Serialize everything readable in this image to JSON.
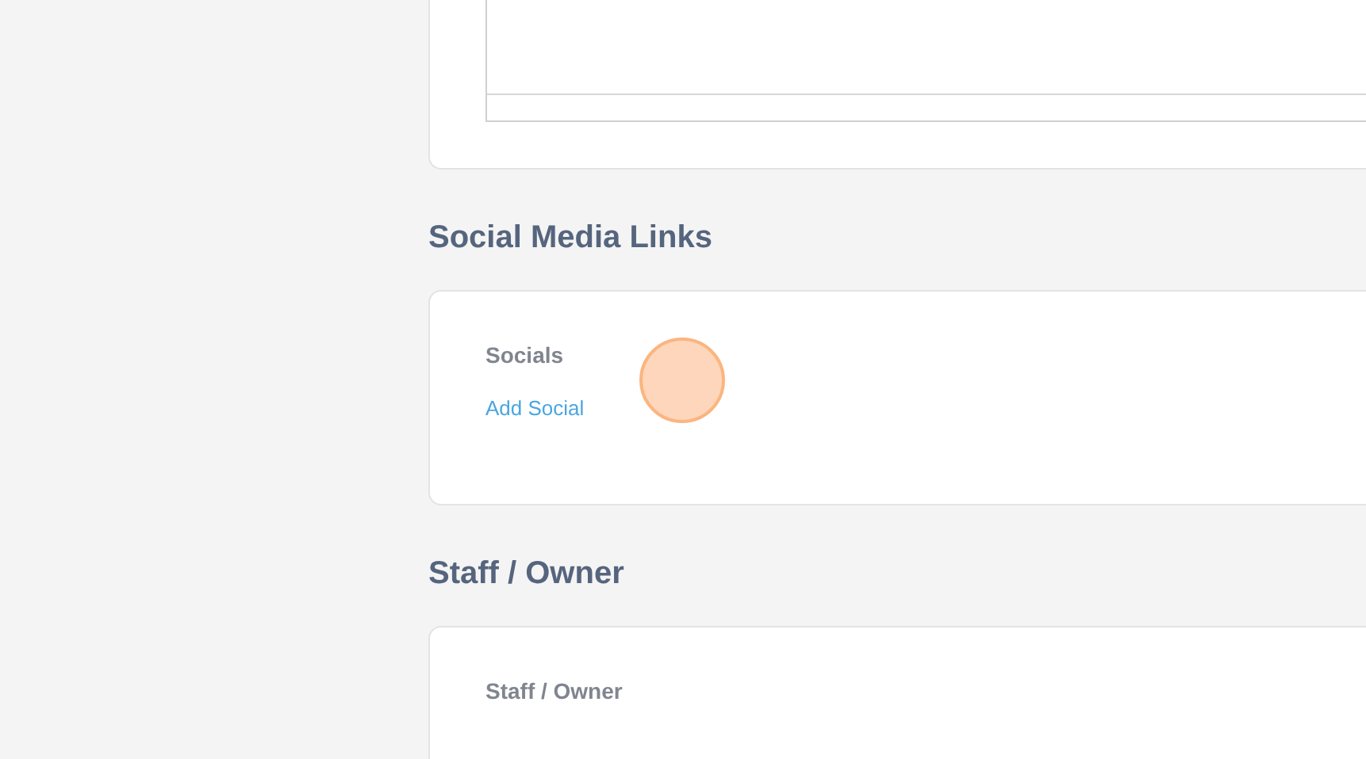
{
  "sections": [
    {
      "heading": "Social Media Links",
      "field_label": "Socials",
      "link": "Add Social"
    },
    {
      "heading": "Staff / Owner",
      "field_label": "Staff / Owner"
    }
  ]
}
